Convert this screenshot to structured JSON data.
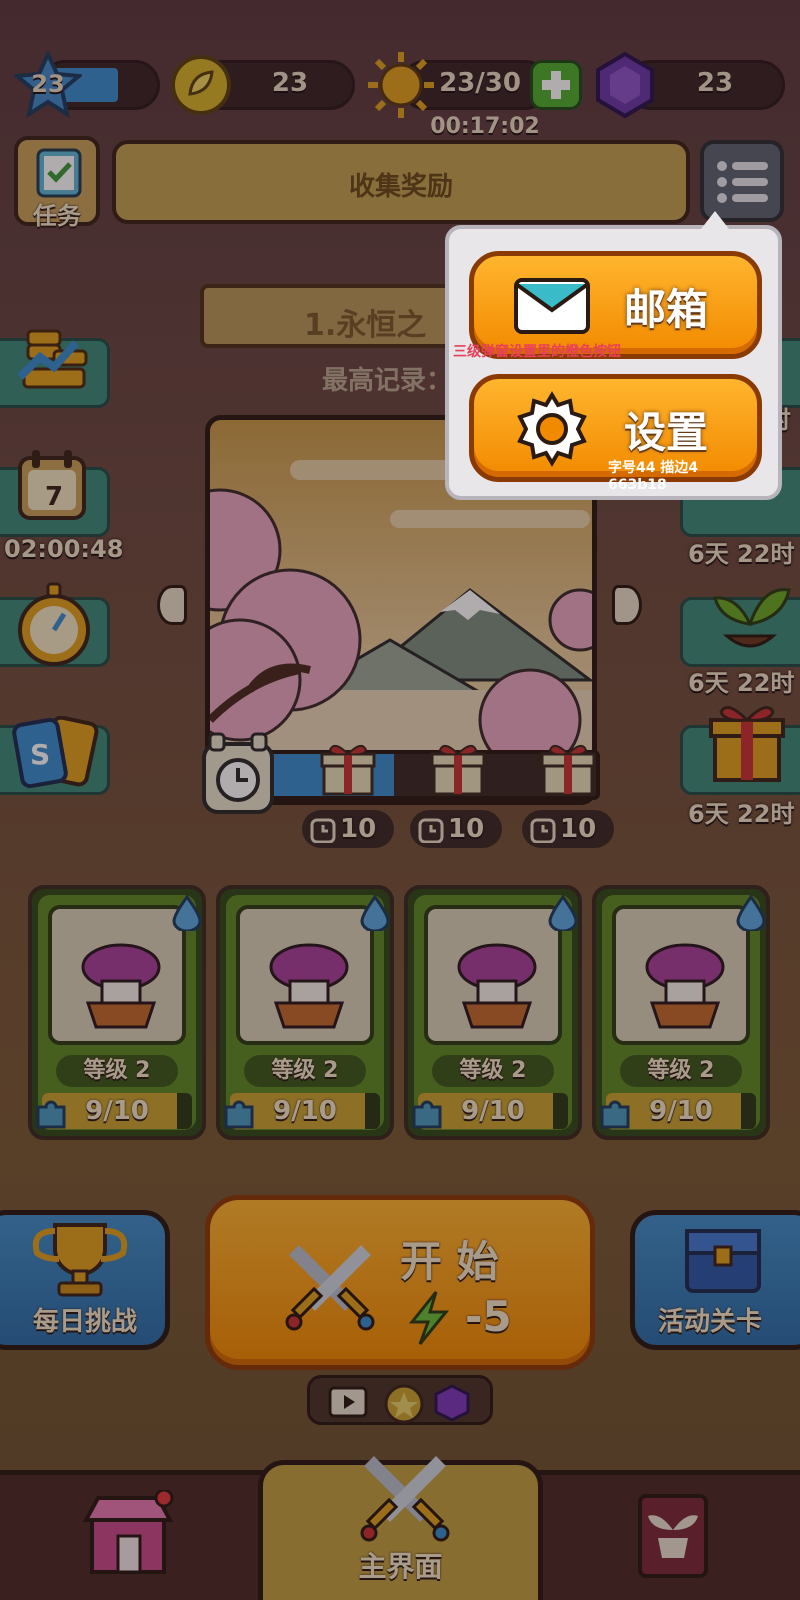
{
  "top_bar": {
    "player_level": "23",
    "leaf_count": "23",
    "energy": "23/30",
    "energy_timer": "00:17:02",
    "gem_count": "23"
  },
  "task_button": {
    "label": "任务"
  },
  "collect_banner": {
    "label": "收集奖励"
  },
  "stage": {
    "title": "1.永恒之",
    "best_record_label": "最高记录："
  },
  "popup": {
    "mail_label": "邮箱",
    "settings_label": "设置",
    "note_top": "三级弹窗设置里的橙色按钮",
    "note_bottom": "字号44 描边4 663b18"
  },
  "left_side": {
    "calendar_day": "7",
    "calendar_timer": "02:00:48"
  },
  "right_side": {
    "timer_1": "2时",
    "timer_2": "6天 22时",
    "timer_3": "6天 22时",
    "timer_4": "6天 22时"
  },
  "gifts": [
    {
      "count": "10"
    },
    {
      "count": "10"
    },
    {
      "count": "10"
    }
  ],
  "cards": [
    {
      "level": "等级 2",
      "progress": "9/10",
      "progress_fraction": 0.9
    },
    {
      "level": "等级 2",
      "progress": "9/10",
      "progress_fraction": 0.9
    },
    {
      "level": "等级 2",
      "progress": "9/10",
      "progress_fraction": 0.9
    },
    {
      "level": "等级 2",
      "progress": "9/10",
      "progress_fraction": 0.9
    }
  ],
  "actions": {
    "daily_challenge": "每日挑战",
    "start": "开 始",
    "start_cost": "-5",
    "event_level": "活动关卡"
  },
  "bottom_nav": {
    "main": "主界面"
  },
  "colors": {
    "accent_orange": "#f28a00",
    "popup_bg": "#e9e6ea",
    "card_green": "#5f8a24"
  },
  "icons": [
    "star-level-icon",
    "leaf-icon",
    "sun-icon",
    "plus-icon",
    "gem-icon",
    "clipboard-check-icon",
    "list-menu-icon",
    "mail-icon",
    "gear-icon",
    "chart-coins-icon",
    "calendar-icon",
    "stopwatch-icon",
    "cards-icon",
    "pot-plant-icon",
    "gift-icon",
    "alarm-clock-icon",
    "water-drop-icon",
    "puzzle-icon",
    "trophy-icon",
    "crossed-swords-icon",
    "lightning-icon",
    "treasure-chest-icon",
    "video-icon",
    "shop-icon"
  ]
}
